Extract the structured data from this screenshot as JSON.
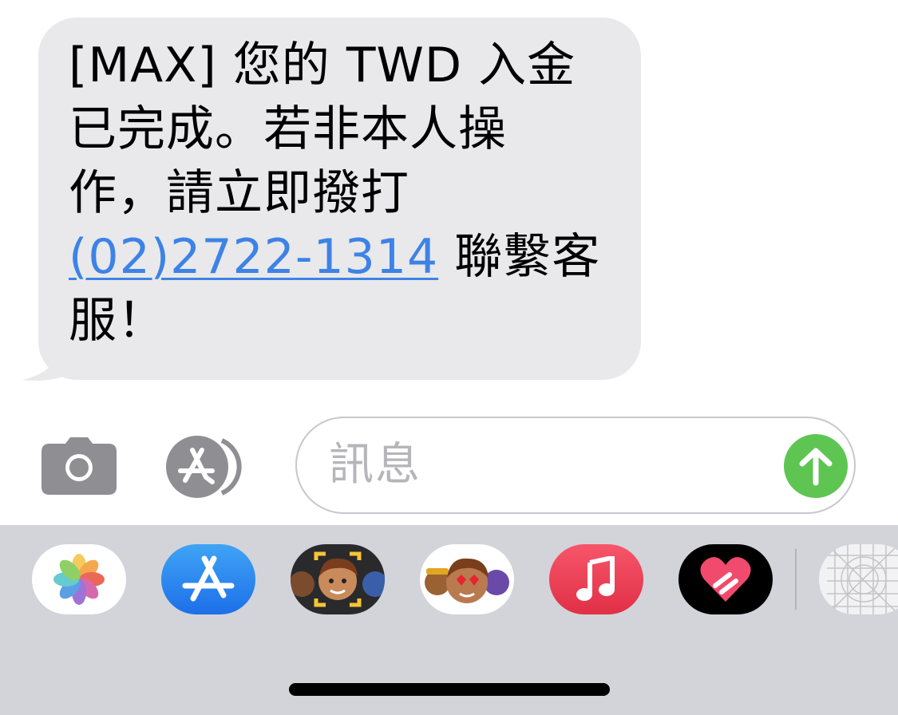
{
  "message": {
    "lines": [
      "[MAX] 您的 TWD 入金",
      "已完成。若非本人操",
      "作，請立即撥打"
    ],
    "phone": "(02)2722-1314",
    "after_phone": " 聯繫客",
    "last_line": "服！"
  },
  "compose": {
    "placeholder": "訊息"
  },
  "colors": {
    "bubble": "#e9e9eb",
    "link": "#3d83e6",
    "send": "#5ec553",
    "drawer": "#d2d4da"
  },
  "drawer_apps": [
    {
      "icon": "photos-icon"
    },
    {
      "icon": "app-store-icon"
    },
    {
      "icon": "memoji-stickers-icon"
    },
    {
      "icon": "animoji-icon"
    },
    {
      "icon": "music-icon"
    },
    {
      "icon": "digital-touch-icon"
    },
    {
      "icon": "more-apps-icon"
    }
  ]
}
